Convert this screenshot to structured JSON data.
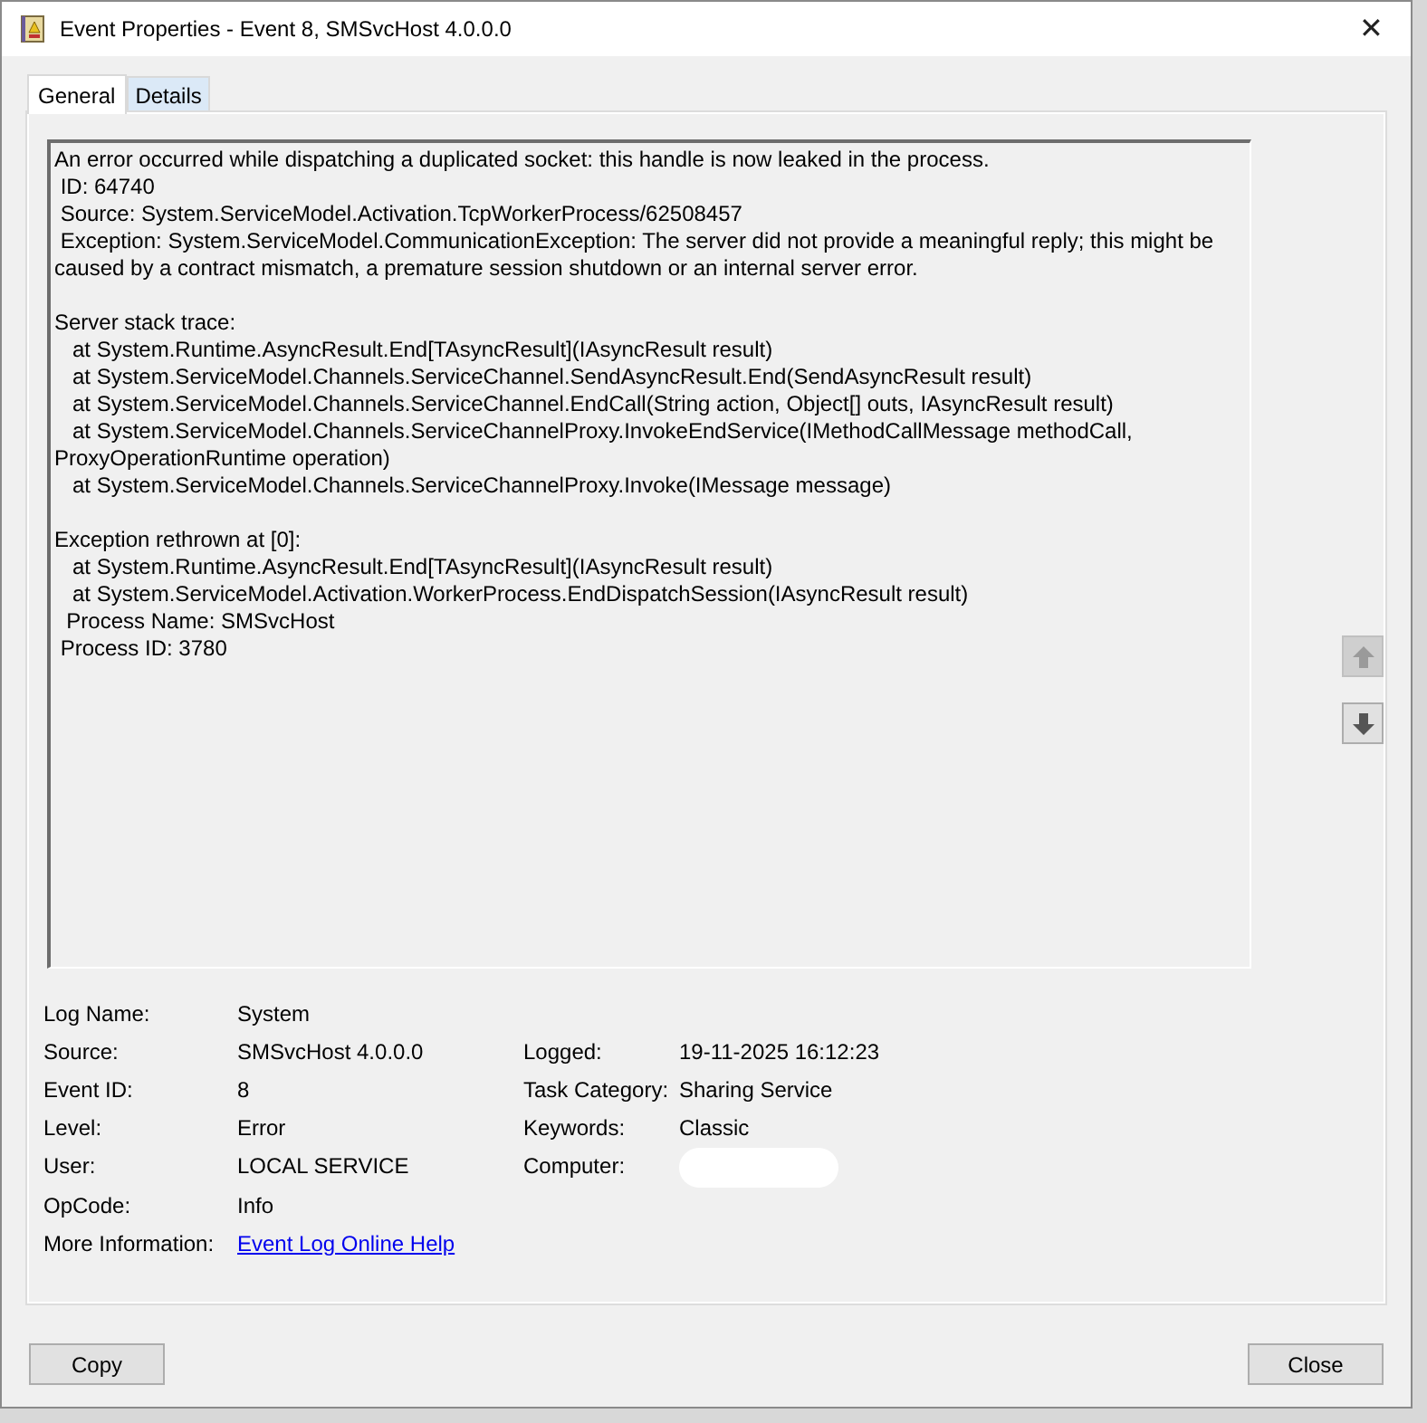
{
  "window": {
    "title": "Event Properties - Event 8, SMSvcHost 4.0.0.0",
    "close": "✕"
  },
  "tabs": [
    {
      "label": "General",
      "selected": true
    },
    {
      "label": "Details",
      "selected": false
    }
  ],
  "description": {
    "paragraphs": [
      [
        "An error occurred while dispatching a duplicated socket: this handle is now leaked in the process.",
        " ID: 64740",
        " Source: System.ServiceModel.Activation.TcpWorkerProcess/62508457",
        " Exception: System.ServiceModel.CommunicationException: The server did not provide a meaningful reply; this might be",
        "caused by a contract mismatch, a premature session shutdown or an internal server error."
      ],
      [
        "Server stack trace: ",
        "   at System.Runtime.AsyncResult.End[TAsyncResult](IAsyncResult result)",
        "   at System.ServiceModel.Channels.ServiceChannel.SendAsyncResult.End(SendAsyncResult result)",
        "   at System.ServiceModel.Channels.ServiceChannel.EndCall(String action, Object[] outs, IAsyncResult result)",
        "   at System.ServiceModel.Channels.ServiceChannelProxy.InvokeEndService(IMethodCallMessage methodCall,",
        "ProxyOperationRuntime operation)",
        "   at System.ServiceModel.Channels.ServiceChannelProxy.Invoke(IMessage message)"
      ],
      [
        "Exception rethrown at [0]: ",
        "   at System.Runtime.AsyncResult.End[TAsyncResult](IAsyncResult result)",
        "   at System.ServiceModel.Activation.WorkerProcess.EndDispatchSession(IAsyncResult result)",
        "  Process Name: SMSvcHost",
        " Process ID: 3780"
      ]
    ]
  },
  "nav_buttons": [
    {
      "kind": "up",
      "disabled": true
    },
    {
      "kind": "down",
      "disabled": false
    }
  ],
  "properties": [
    [
      {
        "label": "Log Name:",
        "value": "System"
      }
    ],
    [
      {
        "label": "Source:",
        "value": "SMSvcHost 4.0.0.0"
      },
      {
        "label": "Logged:",
        "value": "19-11-2025 16:12:23"
      }
    ],
    [
      {
        "label": "Event ID:",
        "value": "8"
      },
      {
        "label": "Task Category:",
        "value": "Sharing Service"
      }
    ],
    [
      {
        "label": "Level:",
        "value": "Error"
      },
      {
        "label": "Keywords:",
        "value": "Classic"
      }
    ],
    [
      {
        "label": "User:",
        "value": "LOCAL SERVICE"
      },
      {
        "label": "Computer:",
        "kind": "redacted"
      }
    ],
    [
      {
        "label": "OpCode:",
        "value": "Info"
      }
    ],
    [
      {
        "label": "More Information:",
        "value": "Event Log Online Help",
        "kind": "link"
      }
    ]
  ],
  "buttons": [
    "Copy",
    "Close"
  ]
}
